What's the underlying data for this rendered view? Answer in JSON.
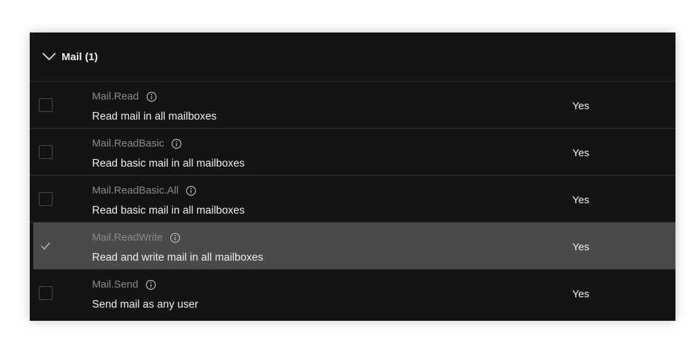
{
  "group": {
    "title": "Mail (1)"
  },
  "permissions": [
    {
      "name": "Mail.Read",
      "description": "Read mail in all mailboxes",
      "admin_consent": "Yes",
      "checked": false
    },
    {
      "name": "Mail.ReadBasic",
      "description": "Read basic mail in all mailboxes",
      "admin_consent": "Yes",
      "checked": false
    },
    {
      "name": "Mail.ReadBasic.All",
      "description": "Read basic mail in all mailboxes",
      "admin_consent": "Yes",
      "checked": false
    },
    {
      "name": "Mail.ReadWrite",
      "description": "Read and write mail in all mailboxes",
      "admin_consent": "Yes",
      "checked": true
    },
    {
      "name": "Mail.Send",
      "description": "Send mail as any user",
      "admin_consent": "Yes",
      "checked": false
    }
  ],
  "icons": {
    "expand": "chevron-down-icon",
    "info": "info-icon",
    "check": "checkmark-icon"
  },
  "colors": {
    "panel_background": "#141414",
    "selected_row_background": "#4a4a4a",
    "permission_name": "#8a8a8a",
    "text": "#eeeeee"
  }
}
